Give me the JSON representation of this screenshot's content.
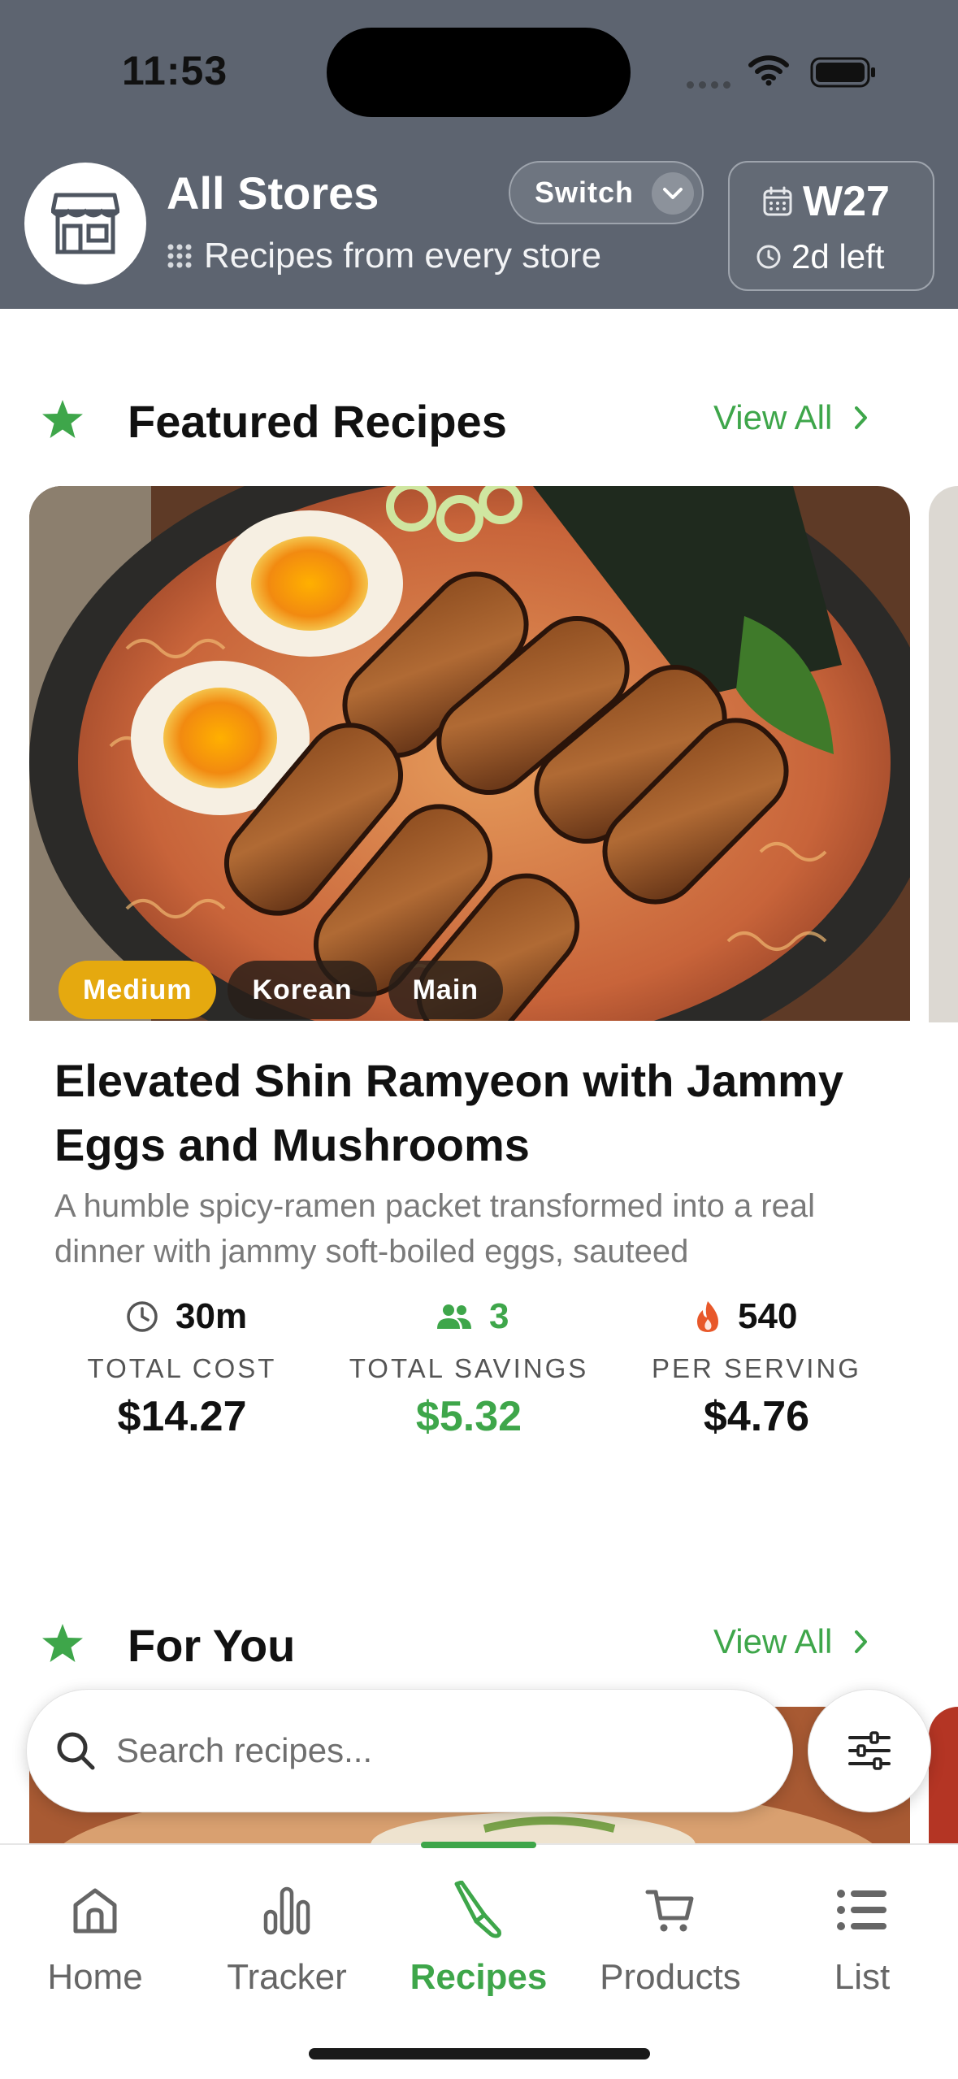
{
  "status_bar": {
    "time": "11:53"
  },
  "header": {
    "store_title": "All Stores",
    "store_subtitle": "Recipes from every store",
    "switch_label": "Switch",
    "week_label": "W27",
    "time_left": "2d left"
  },
  "featured": {
    "title": "Featured Recipes",
    "view_all": "View All",
    "recipe": {
      "tags": [
        "Medium",
        "Korean",
        "Main"
      ],
      "title": "Elevated Shin Ramyeon with Jammy Eggs and Mushrooms",
      "description": "A humble spicy-ramen packet transformed into a real dinner with jammy soft-boiled eggs, sauteed",
      "time": "30m",
      "servings": "3",
      "calories": "540",
      "total_cost_label": "TOTAL COST",
      "total_cost": "$14.27",
      "total_savings_label": "TOTAL SAVINGS",
      "total_savings": "$5.32",
      "per_serving_label": "PER SERVING",
      "per_serving": "$4.76"
    }
  },
  "for_you": {
    "title": "For You",
    "view_all": "View All"
  },
  "search": {
    "placeholder": "Search recipes..."
  },
  "tabbar": {
    "items": [
      {
        "label": "Home",
        "icon": "home-icon"
      },
      {
        "label": "Tracker",
        "icon": "bar-chart-icon"
      },
      {
        "label": "Recipes",
        "icon": "recipe-icon"
      },
      {
        "label": "Products",
        "icon": "cart-icon"
      },
      {
        "label": "List",
        "icon": "list-icon"
      }
    ],
    "active": "Recipes"
  },
  "colors": {
    "accent_green": "#3ea64a",
    "header_bg": "#5d6470",
    "medium_tag": "#e5a90f",
    "calorie_flame": "#e8582a"
  }
}
